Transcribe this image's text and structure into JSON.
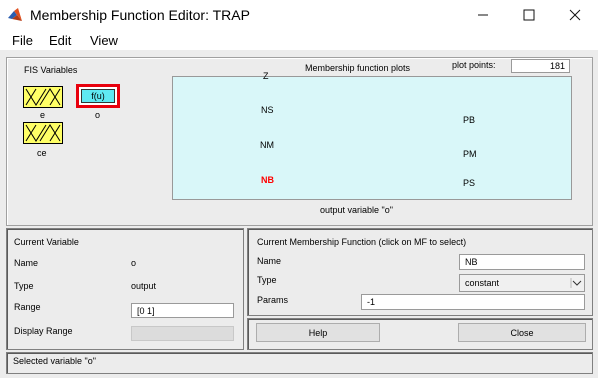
{
  "window": {
    "title": "Membership Function Editor: TRAP",
    "controls": {
      "minimize_icon": "minimize-icon",
      "maximize_icon": "maximize-icon",
      "close_icon": "close-icon"
    }
  },
  "menu": [
    "File",
    "Edit",
    "View"
  ],
  "fis_variables": {
    "heading": "FIS Variables",
    "inputs": [
      {
        "label": "e"
      },
      {
        "label": "ce"
      }
    ],
    "output": {
      "box_text": "f(u)",
      "label": "o",
      "highlight_color": "#e8000d"
    }
  },
  "plot": {
    "title": "Membership function plots",
    "points_label": "plot points:",
    "points_value": "181",
    "mf_labels": [
      "Z",
      "NS",
      "NM",
      "NB",
      "PB",
      "PM",
      "PS"
    ],
    "selected_mf": "NB",
    "selected_color": "#ff0000",
    "bg_color": "#d9f7f9",
    "xlabel": "output variable \"o\""
  },
  "current_variable": {
    "heading": "Current Variable",
    "name_label": "Name",
    "name_value": "o",
    "type_label": "Type",
    "type_value": "output",
    "range_label": "Range",
    "range_value": "[0 1]",
    "display_range_label": "Display Range",
    "display_range_value": ""
  },
  "current_mf": {
    "heading": "Current Membership Function (click on MF to select)",
    "name_label": "Name",
    "name_value": "NB",
    "type_label": "Type",
    "type_value": "constant",
    "params_label": "Params",
    "params_value": "-1"
  },
  "buttons": {
    "help": "Help",
    "close": "Close"
  },
  "status": "Selected variable \"o\""
}
